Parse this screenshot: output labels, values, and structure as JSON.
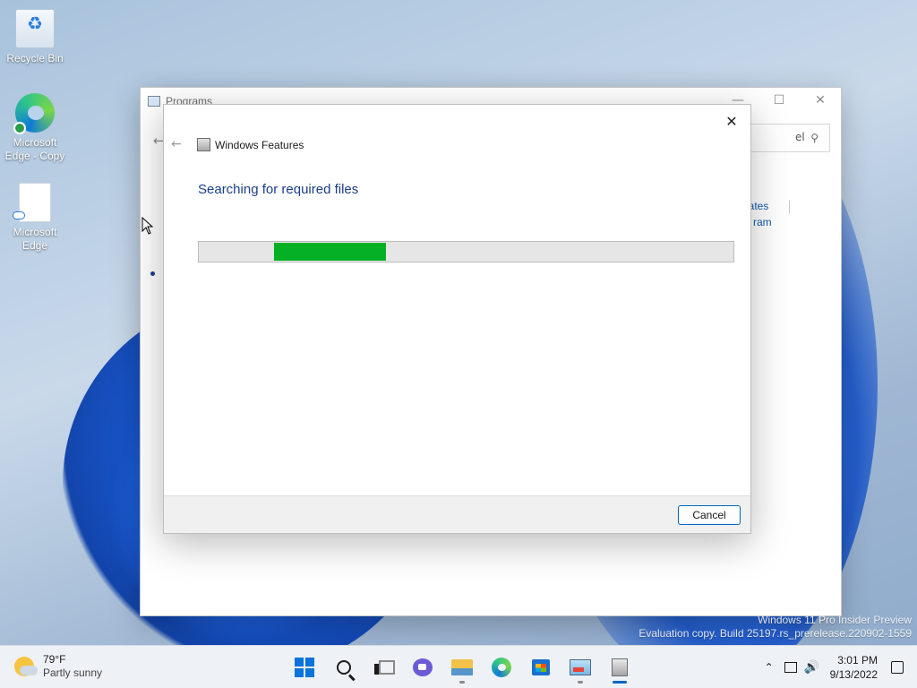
{
  "desktop": {
    "icons": [
      {
        "label": "Recycle Bin"
      },
      {
        "label": "Microsoft Edge - Copy"
      },
      {
        "label": "Microsoft Edge"
      }
    ],
    "watermark": {
      "line1": "Windows 11 Pro Insider Preview",
      "line2": "Evaluation copy. Build 25197.rs_prerelease.220902-1559"
    }
  },
  "background_window": {
    "title": "Programs",
    "search_partial": "el",
    "links": [
      "dates",
      "ram"
    ]
  },
  "dialog": {
    "app_title": "Windows Features",
    "heading": "Searching for required files",
    "progress": {
      "indeterminate_segment_start": 0.14,
      "indeterminate_segment_end": 0.35,
      "color": "#06b025"
    },
    "cancel_label": "Cancel",
    "close_glyph": "✕",
    "back_glyph": "←"
  },
  "taskbar": {
    "weather": {
      "temp": "79°F",
      "condition": "Partly sunny"
    },
    "pinned": [
      {
        "name": "start-button",
        "icon": "windows-logo-icon"
      },
      {
        "name": "search-button",
        "icon": "search-icon"
      },
      {
        "name": "task-view-button",
        "icon": "task-view-icon"
      },
      {
        "name": "chat-button",
        "icon": "chat-icon"
      },
      {
        "name": "file-explorer-button",
        "icon": "folder-icon"
      },
      {
        "name": "edge-button",
        "icon": "edge-icon"
      },
      {
        "name": "store-button",
        "icon": "store-icon"
      },
      {
        "name": "control-panel-button",
        "icon": "control-panel-icon"
      },
      {
        "name": "windows-features-button",
        "icon": "windows-features-icon"
      }
    ],
    "tray": {
      "chevron": "^",
      "volume": "🔊"
    },
    "clock": {
      "time": "3:01 PM",
      "date": "9/13/2022"
    }
  },
  "colors": {
    "accent": "#0067c0",
    "progress_green": "#06b025",
    "heading_blue": "#1b3f8a"
  }
}
